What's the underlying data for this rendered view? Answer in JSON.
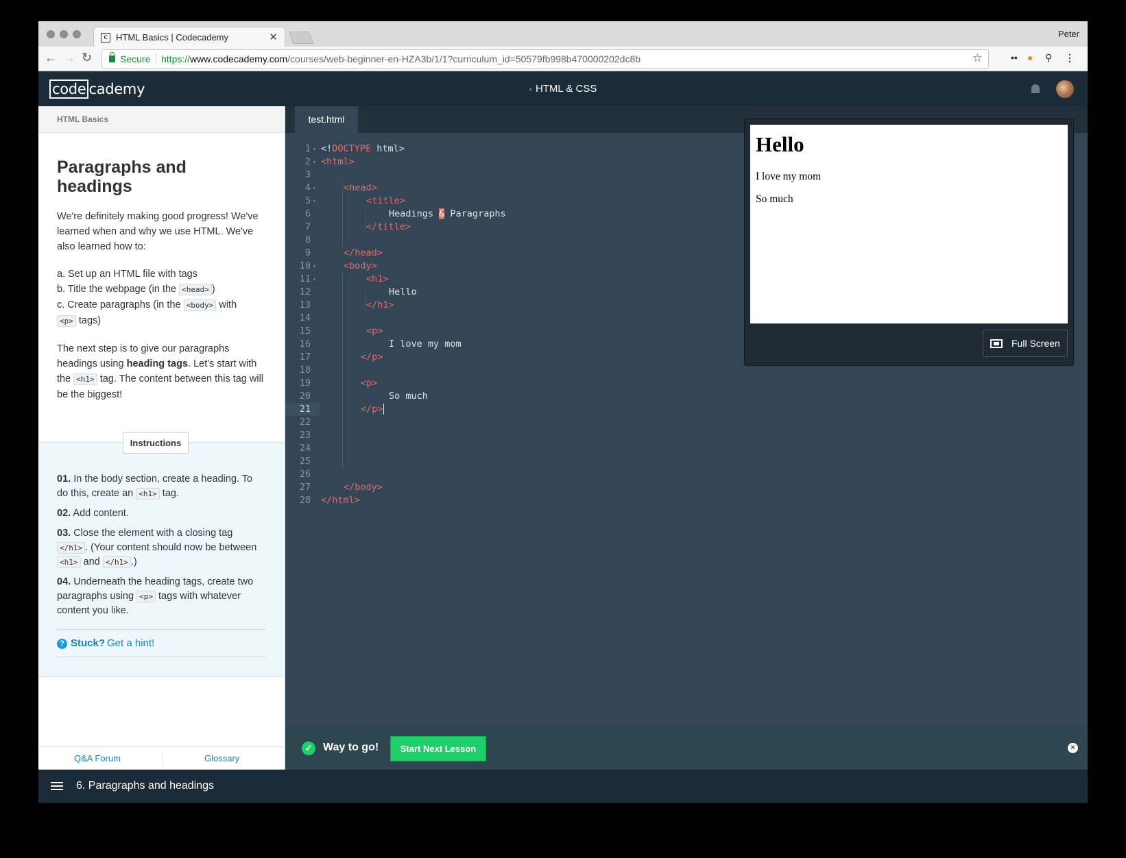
{
  "browser": {
    "tab_title": "HTML Basics | Codecademy",
    "profile": "Peter",
    "secure_label": "Secure",
    "url_scheme": "https://",
    "url_host": "www.codecademy.com",
    "url_path": "/courses/web-beginner-en-HZA3b/1/1?curriculum_id=50579fb998b470000202dc8b"
  },
  "header": {
    "logo_left": "code",
    "logo_right": "cademy",
    "course": "HTML & CSS"
  },
  "lesson": {
    "section": "HTML Basics",
    "title": "Paragraphs and headings",
    "intro": "We're definitely making good progress! We've learned when and why we use HTML. We've also learned how to:",
    "steps": {
      "a": "a. Set up an HTML file with tags",
      "b_pre": "b. Title the webpage (in the ",
      "b_code": "<head>",
      "b_post": ")",
      "c_pre": "c. Create paragraphs (in the ",
      "c_code": "<body>",
      "c_mid": " with ",
      "c_code2": "<p>",
      "c_post": " tags)"
    },
    "next": {
      "pre": "The next step is to give our paragraphs headings using ",
      "bold": "heading tags",
      "mid": ". Let's start with the ",
      "code": "<h1>",
      "post": " tag. The content between this tag will be the biggest!"
    },
    "instructions_label": "Instructions",
    "instructions": {
      "i1_num": "01.",
      "i1_pre": " In the body section, create a heading. To do this, create an ",
      "i1_code": "<h1>",
      "i1_post": " tag.",
      "i2_num": "02.",
      "i2_text": " Add content.",
      "i3_num": "03.",
      "i3_pre": " Close the element with a closing tag ",
      "i3_code": "</h1>",
      "i3_mid": ". (Your content should now be between ",
      "i3_code2": "<h1>",
      "i3_and": " and ",
      "i3_code3": "</h1>",
      "i3_post": ".)",
      "i4_num": "04.",
      "i4_pre": " Underneath the heading tags, create two paragraphs using ",
      "i4_code": "<p>",
      "i4_post": " tags with whatever content you like."
    },
    "stuck": "Stuck?",
    "hint": "Get a hint!",
    "footer_links": [
      "Q&A Forum",
      "Glossary"
    ]
  },
  "editor": {
    "file_tab": "test.html",
    "line_numbers": [
      "1",
      "2",
      "3",
      "4",
      "5",
      "6",
      "7",
      "8",
      "9",
      "10",
      "11",
      "12",
      "13",
      "14",
      "15",
      "16",
      "17",
      "18",
      "19",
      "20",
      "21",
      "22",
      "23",
      "24",
      "25",
      "26",
      "27",
      "28"
    ],
    "code": {
      "l1a": "<!",
      "l1b": "DOCTYPE",
      "l1c": " html>",
      "l2": "<html>",
      "l4": "<head>",
      "l5": "<title>",
      "l6a": "Headings ",
      "l6b": "&",
      "l6c": " Paragraphs",
      "l7": "</title>",
      "l9": "</head>",
      "l10": "<body>",
      "l11": "<h1>",
      "l12": "Hello",
      "l13": "</h1>",
      "l15": "<p>",
      "l16": "I love my mom",
      "l17": "</p>",
      "l19": "<p>",
      "l20": "So much",
      "l21": "</p>",
      "l27": "</body>",
      "l28": "</html>"
    }
  },
  "preview": {
    "h1": "Hello",
    "p1": "I love my mom",
    "p2": "So much",
    "fullscreen": "Full Screen"
  },
  "success": {
    "message": "Way to go!",
    "button": "Start Next Lesson"
  },
  "bottom": {
    "lesson_name": "6. Paragraphs and headings"
  },
  "colors": {
    "accent_green": "#1ecf6a",
    "tag_red": "#e06c6c",
    "editor_bg": "#344655",
    "link_blue": "#1e7fb8"
  }
}
